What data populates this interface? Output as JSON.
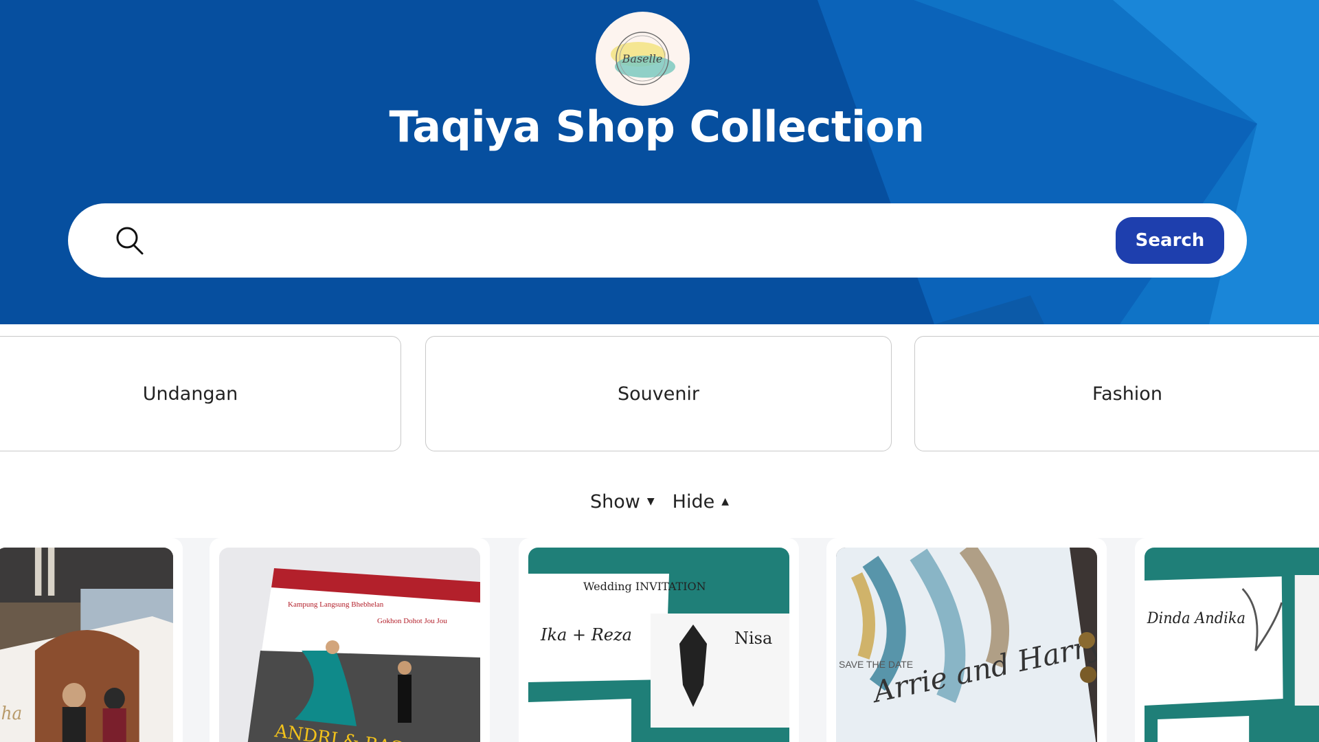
{
  "header": {
    "logo_text": "Baselle",
    "title": "Taqiya Shop Collection"
  },
  "search": {
    "placeholder": "",
    "button_label": "Search"
  },
  "categories": [
    {
      "label": "Undangan"
    },
    {
      "label": "Souvenir"
    },
    {
      "label": "Fashion"
    }
  ],
  "toggles": {
    "show_label": "Show",
    "hide_label": "Hide"
  },
  "products": [
    {
      "image": "wedding-photo-invitation"
    },
    {
      "image_text": "ANDRI & BASA",
      "image": "batak-invitation"
    },
    {
      "image_text_1": "Wedding INVITATION",
      "image_text_2": "Ika + Reza",
      "image_text_3": "Nisa",
      "image": "wayang-invitation"
    },
    {
      "image_text_1": "SAVE THE DATE",
      "image_text_2": "Arrie and Harry",
      "image": "feather-invitation"
    },
    {
      "image_text": "Dinda Andika",
      "image": "floral-invitation"
    }
  ],
  "colors": {
    "hero_primary": "#064f9f",
    "hero_secondary": "#0a79d0",
    "search_button": "#1e3fae"
  }
}
